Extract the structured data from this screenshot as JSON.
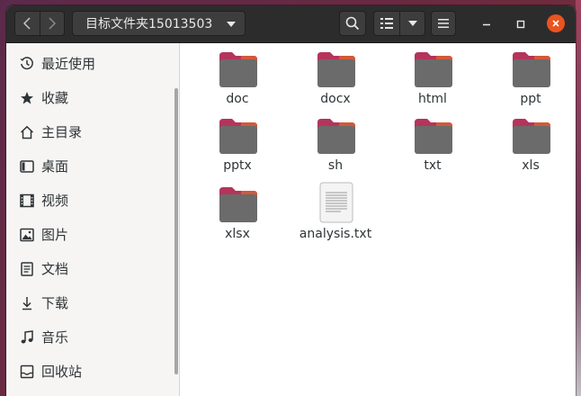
{
  "window": {
    "path_label": "目标文件夹15013503"
  },
  "headerbar": {
    "back_icon": "chevron-left-icon",
    "forward_icon": "chevron-right-icon",
    "search_icon": "search-icon",
    "view_icon": "list-view-icon",
    "menu_icon": "hamburger-menu-icon",
    "minimize_icon": "minimize-icon",
    "maximize_icon": "maximize-icon",
    "close_icon": "close-icon",
    "close_color": "#e95420"
  },
  "sidebar": {
    "items": [
      {
        "label": "最近使用",
        "icon": "clock-icon"
      },
      {
        "label": "收藏",
        "icon": "star-icon"
      },
      {
        "label": "主目录",
        "icon": "home-icon"
      },
      {
        "label": "桌面",
        "icon": "desktop-icon"
      },
      {
        "label": "视频",
        "icon": "video-icon"
      },
      {
        "label": "图片",
        "icon": "picture-icon"
      },
      {
        "label": "文档",
        "icon": "document-icon"
      },
      {
        "label": "下载",
        "icon": "download-icon"
      },
      {
        "label": "音乐",
        "icon": "music-icon"
      },
      {
        "label": "回收站",
        "icon": "trash-icon"
      }
    ]
  },
  "files": [
    {
      "name": "doc",
      "type": "folder"
    },
    {
      "name": "docx",
      "type": "folder"
    },
    {
      "name": "html",
      "type": "folder"
    },
    {
      "name": "ppt",
      "type": "folder"
    },
    {
      "name": "pptx",
      "type": "folder"
    },
    {
      "name": "sh",
      "type": "folder"
    },
    {
      "name": "txt",
      "type": "folder"
    },
    {
      "name": "xls",
      "type": "folder"
    },
    {
      "name": "xlsx",
      "type": "folder"
    },
    {
      "name": "analysis.txt",
      "type": "text-file"
    }
  ],
  "colors": {
    "folder_tab": "#b5345b",
    "folder_body": "#6b6b6b",
    "accent": "#e95420"
  }
}
